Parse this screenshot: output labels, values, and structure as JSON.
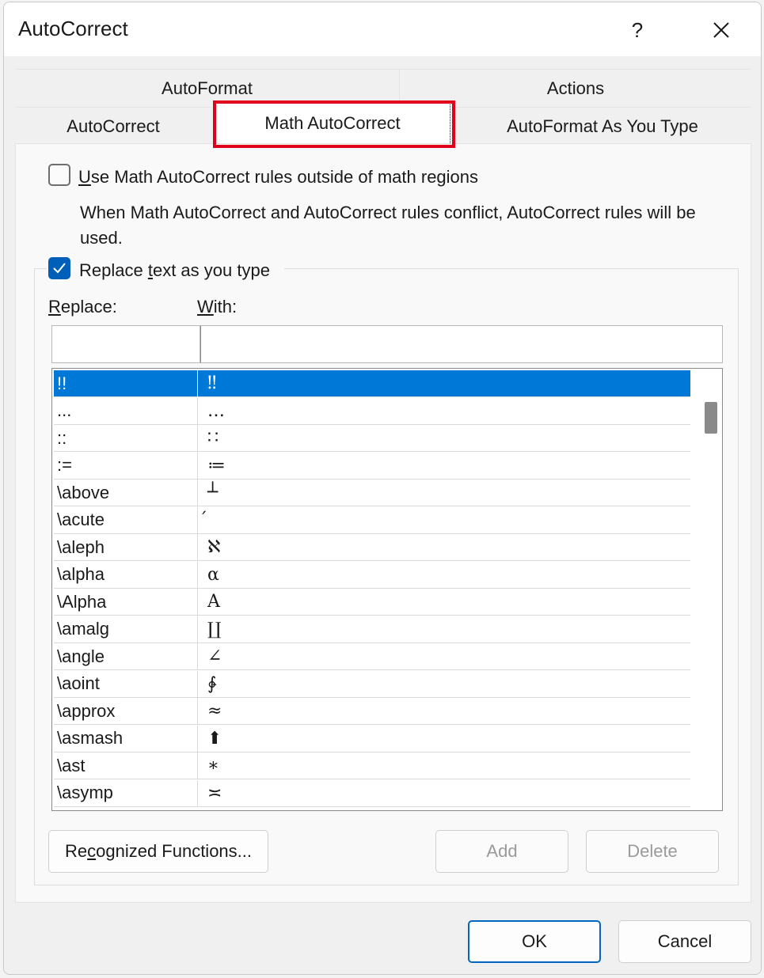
{
  "window": {
    "title": "AutoCorrect",
    "help_label": "?"
  },
  "tabs": {
    "autoformat": "AutoFormat",
    "actions": "Actions",
    "autocorrect": "AutoCorrect",
    "math_autocorrect": "Math AutoCorrect",
    "autoformat_as_you_type": "AutoFormat As You Type",
    "active": "Math AutoCorrect",
    "highlight_color": "#e0001b"
  },
  "options": {
    "use_math_outside": {
      "label_pre": "U",
      "label_post": "se Math AutoCorrect rules outside of math regions",
      "checked": false
    },
    "conflict_note": "When Math AutoCorrect and AutoCorrect rules conflict, AutoCorrect rules will be used.",
    "replace_text": {
      "label_pre": "Replace ",
      "label_u": "t",
      "label_post": "ext as you type",
      "checked": true
    }
  },
  "fields": {
    "replace_label_u": "R",
    "replace_label_rest": "eplace:",
    "with_label_u": "W",
    "with_label_rest": "ith:",
    "replace_value": "",
    "with_value": ""
  },
  "entries": [
    {
      "replace": "!!",
      "with": "‼",
      "selected": true
    },
    {
      "replace": "...",
      "with": "…"
    },
    {
      "replace": "::",
      "with": "∷"
    },
    {
      "replace": ":=",
      "with": "≔"
    },
    {
      "replace": "\\above",
      "with": "┴"
    },
    {
      "replace": "\\acute",
      "with": "́"
    },
    {
      "replace": "\\aleph",
      "with": "ℵ"
    },
    {
      "replace": "\\alpha",
      "with": "α"
    },
    {
      "replace": "\\Alpha",
      "with": "A"
    },
    {
      "replace": "\\amalg",
      "with": "∐"
    },
    {
      "replace": "\\angle",
      "with": "∠"
    },
    {
      "replace": "\\aoint",
      "with": "∳"
    },
    {
      "replace": "\\approx",
      "with": "≈"
    },
    {
      "replace": "\\asmash",
      "with": "⬆"
    },
    {
      "replace": "\\ast",
      "with": "∗"
    },
    {
      "replace": "\\asymp",
      "with": "≍"
    }
  ],
  "buttons": {
    "recognized_pre": "Re",
    "recognized_u": "c",
    "recognized_post": "ognized Functions...",
    "add": "Add",
    "delete": "Delete",
    "ok": "OK",
    "cancel": "Cancel"
  },
  "colors": {
    "selection": "#0078d7",
    "checkbox_checked": "#005fb8",
    "ok_border": "#0067c0"
  }
}
